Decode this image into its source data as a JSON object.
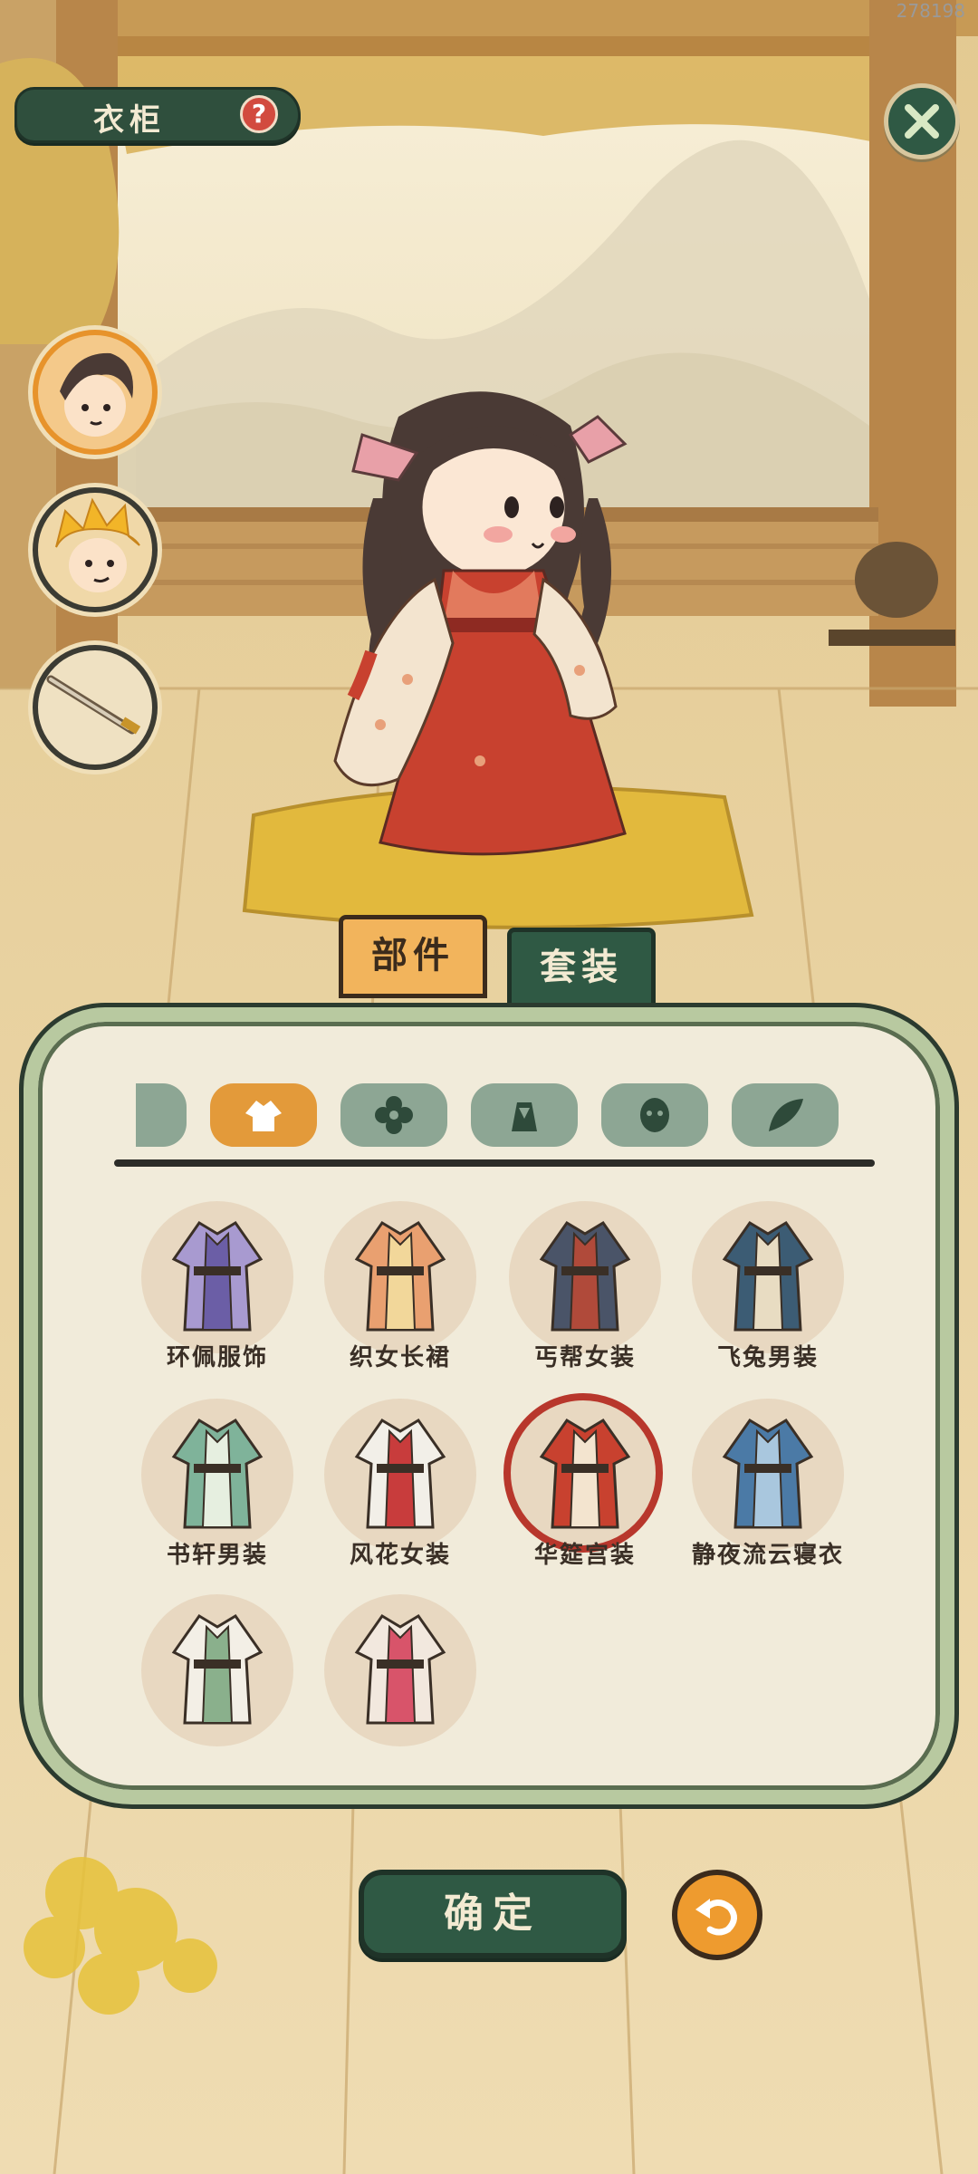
{
  "corner_id": "278198",
  "header": {
    "title": "衣柜",
    "help_symbol": "?"
  },
  "tabs": [
    {
      "label": "部件",
      "selected": true
    },
    {
      "label": "套装",
      "selected": false
    }
  ],
  "categories": [
    {
      "icon": "partial-category-icon",
      "selected": false
    },
    {
      "icon": "clothing-icon",
      "selected": true
    },
    {
      "icon": "flower-icon",
      "selected": false
    },
    {
      "icon": "hat-icon",
      "selected": false
    },
    {
      "icon": "face-icon",
      "selected": false
    },
    {
      "icon": "leaf-icon",
      "selected": false
    }
  ],
  "items": [
    {
      "label": "环佩服饰",
      "colors": [
        "#a89ad0",
        "#6b5ea6"
      ],
      "equipped": false
    },
    {
      "label": "织女长裙",
      "colors": [
        "#e9a070",
        "#f2d79a"
      ],
      "equipped": false
    },
    {
      "label": "丐帮女装",
      "colors": [
        "#4a5468",
        "#b04a3a"
      ],
      "equipped": false
    },
    {
      "label": "飞兔男装",
      "colors": [
        "#3c5c74",
        "#e8dcc2"
      ],
      "equipped": false
    },
    {
      "label": "书轩男装",
      "colors": [
        "#7fb39a",
        "#e6efe0"
      ],
      "equipped": false
    },
    {
      "label": "风花女装",
      "colors": [
        "#f2efe8",
        "#c83c3c"
      ],
      "equipped": false
    },
    {
      "label": "华筵宫装",
      "colors": [
        "#c8412f",
        "#f3e4cf"
      ],
      "equipped": true
    },
    {
      "label": "静夜流云寝衣",
      "colors": [
        "#4b7aa6",
        "#a9c7de"
      ],
      "equipped": false
    },
    {
      "label": "",
      "colors": [
        "#f3efe6",
        "#8ab08c"
      ],
      "equipped": false
    },
    {
      "label": "",
      "colors": [
        "#f2e8de",
        "#d8546a"
      ],
      "equipped": false
    }
  ],
  "buttons": {
    "confirm": "确定"
  },
  "characters": [
    {
      "name": "dark-haired-boy-portrait",
      "selected": true
    },
    {
      "name": "golden-haired-monkey-portrait",
      "selected": false
    },
    {
      "name": "sword-portrait",
      "selected": false
    }
  ]
}
